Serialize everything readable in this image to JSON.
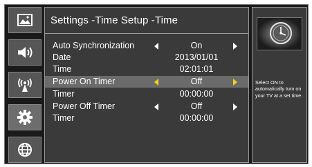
{
  "colors": {
    "selected_arrow": "#f2d21a",
    "panel_bg": "#3a3a3a",
    "selected_row_bg": "#6b6b6b",
    "icon_tile_bg": "#565656"
  },
  "sidebar": {
    "items": [
      {
        "icon": "picture-icon",
        "name": "Picture"
      },
      {
        "icon": "speaker-icon",
        "name": "Sound"
      },
      {
        "icon": "broadcast-icon",
        "name": "Channel"
      },
      {
        "icon": "gear-icon",
        "name": "Settings"
      },
      {
        "icon": "globe-icon",
        "name": "Network"
      }
    ],
    "active_index": 3
  },
  "header": {
    "title": "Settings -Time Setup -Time"
  },
  "rows": [
    {
      "label": "Auto Synchronization",
      "value": "On",
      "arrows": true,
      "selected": false
    },
    {
      "label": "Date",
      "value": "2013/01/01",
      "arrows": false,
      "selected": false
    },
    {
      "label": "Time",
      "value": "02:01:01",
      "arrows": false,
      "selected": false
    },
    {
      "label": "Power On Timer",
      "value": "Off",
      "arrows": true,
      "selected": true
    },
    {
      "label": "Timer",
      "value": "00:00:00",
      "arrows": false,
      "selected": false
    },
    {
      "label": "Power Off Timer",
      "value": "Off",
      "arrows": true,
      "selected": false
    },
    {
      "label": "Timer",
      "value": "00:00:00",
      "arrows": false,
      "selected": false
    }
  ],
  "info": {
    "preview_icon": "clock-icon",
    "help_text": "Select ON to automatically turn on your TV at a set time."
  }
}
